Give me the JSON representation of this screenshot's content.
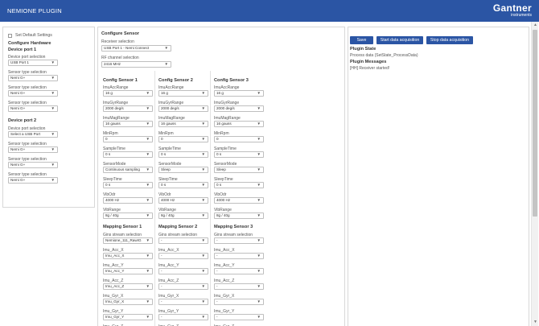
{
  "app": {
    "title": "NEMIONE PLUGIN",
    "logo": {
      "name": "Gantner",
      "sub": "instruments"
    }
  },
  "left": {
    "default_settings": "Set Default Settings",
    "configure_hardware": "Configure Hardware",
    "device_port_1": "Device port 1",
    "device_port_2": "Device port 2",
    "device_port_selection": "Device port selection",
    "sensor_type_selection": "Sensor type selection",
    "port1_value": "USB Port 1",
    "port2_value": "Select a USB Port",
    "sensor_value": "Nemi G+"
  },
  "config": {
    "title": "Configure Sensor",
    "receiver_label": "Receiver selection",
    "receiver_value": "USB Port 1 - Nemi Connect",
    "rf_label": "RF channel selection",
    "rf_value": "2416 MHz"
  },
  "sensors": [
    {
      "title": "Config Sensor 1",
      "fields": [
        {
          "label": "ImuAccRange",
          "value": "16 g"
        },
        {
          "label": "ImuGyrRange",
          "value": "2000 deg/s"
        },
        {
          "label": "ImuMagRange",
          "value": "16 gauss"
        },
        {
          "label": "MinRpm",
          "value": "0"
        },
        {
          "label": "SampleTime",
          "value": "0 s"
        },
        {
          "label": "SensorMode",
          "value": "Continuous sampling"
        },
        {
          "label": "SleepTime",
          "value": "0 s"
        },
        {
          "label": "VibOdr",
          "value": "4000 Hz"
        },
        {
          "label": "VibRange",
          "value": "8g / 40g"
        }
      ],
      "mapping_title": "Mapping Sensor 1",
      "stream_label": "Gins stream selection",
      "stream_value": "Nemione_111_RawIG",
      "mappings": [
        {
          "label": "Imu_Acc_X",
          "value": "Imu_Acc_X"
        },
        {
          "label": "Imu_Acc_Y",
          "value": "Imu_Acc_Y"
        },
        {
          "label": "Imu_Acc_Z",
          "value": "Imu_Acc_Z"
        },
        {
          "label": "Imu_Gyr_X",
          "value": "Imu_Gyr_X"
        },
        {
          "label": "Imu_Gyr_Y",
          "value": "Imu_Gyr_Y"
        },
        {
          "label": "Imu_Gyr_Z",
          "value": ""
        }
      ]
    },
    {
      "title": "Config Sensor 2",
      "fields": [
        {
          "label": "ImuAccRange",
          "value": "16 g"
        },
        {
          "label": "ImuGyrRange",
          "value": "2000 deg/s"
        },
        {
          "label": "ImuMagRange",
          "value": "16 gauss"
        },
        {
          "label": "MinRpm",
          "value": "0"
        },
        {
          "label": "SampleTime",
          "value": "0 s"
        },
        {
          "label": "SensorMode",
          "value": "Sleep"
        },
        {
          "label": "SleepTime",
          "value": "0 s"
        },
        {
          "label": "VibOdr",
          "value": "4000 Hz"
        },
        {
          "label": "VibRange",
          "value": "8g / 40g"
        }
      ],
      "mapping_title": "Mapping Sensor 2",
      "stream_label": "Gins stream selection",
      "stream_value": "-",
      "mappings": [
        {
          "label": "Imu_Acc_X",
          "value": "-"
        },
        {
          "label": "Imu_Acc_Y",
          "value": "-"
        },
        {
          "label": "Imu_Acc_Z",
          "value": "-"
        },
        {
          "label": "Imu_Gyr_X",
          "value": "-"
        },
        {
          "label": "Imu_Gyr_Y",
          "value": "-"
        },
        {
          "label": "Imu_Gyr_Z",
          "value": ""
        }
      ]
    },
    {
      "title": "Config Sensor 3",
      "fields": [
        {
          "label": "ImuAccRange",
          "value": "16 g"
        },
        {
          "label": "ImuGyrRange",
          "value": "2000 deg/s"
        },
        {
          "label": "ImuMagRange",
          "value": "16 gauss"
        },
        {
          "label": "MinRpm",
          "value": "0"
        },
        {
          "label": "SampleTime",
          "value": "0 s"
        },
        {
          "label": "SensorMode",
          "value": "Sleep"
        },
        {
          "label": "SleepTime",
          "value": "0 s"
        },
        {
          "label": "VibOdr",
          "value": "4000 Hz"
        },
        {
          "label": "VibRange",
          "value": "8g / 40g"
        }
      ],
      "mapping_title": "Mapping Sensor 3",
      "stream_label": "Gins stream selection",
      "stream_value": "-",
      "mappings": [
        {
          "label": "Imu_Acc_X",
          "value": "-"
        },
        {
          "label": "Imu_Acc_Y",
          "value": "-"
        },
        {
          "label": "Imu_Acc_Z",
          "value": "-"
        },
        {
          "label": "Imu_Gyr_X",
          "value": "-"
        },
        {
          "label": "Imu_Gyr_Y",
          "value": "-"
        },
        {
          "label": "Imu_Gyr_Z",
          "value": ""
        }
      ]
    }
  ],
  "actions": {
    "save": "Save",
    "start": "Start data acquisition",
    "stop": "Stop data acquisition"
  },
  "plugin": {
    "state_title": "Plugin State",
    "state_value": "Process data (SetState_ProcessData)",
    "messages_title": "Plugin Messages",
    "message": "[HH] Receiver started!"
  },
  "icons": {
    "dropdown": "chevron-down-icon",
    "checkbox": "checkbox-icon",
    "scroll_up": "arrow-up-icon",
    "scroll_down": "arrow-down-icon"
  },
  "colors": {
    "brand": "#2b55a4",
    "border": "#d8d8d8"
  }
}
